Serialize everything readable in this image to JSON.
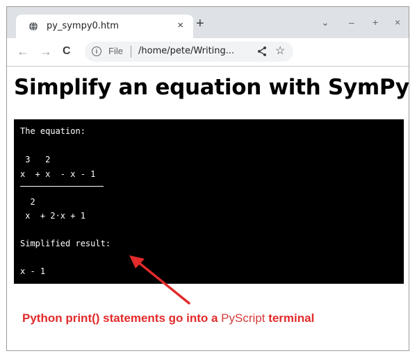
{
  "browser": {
    "tab_title": "py_sympy0.htm",
    "tab_close": "×",
    "new_tab": "+",
    "window_controls": [
      "⌄",
      "–",
      "+",
      "×"
    ],
    "nav": {
      "back": "←",
      "forward": "→",
      "reload": "C"
    },
    "address": {
      "scheme_label": "File",
      "url": "/home/pete/Writing..."
    }
  },
  "page": {
    "heading": "Simplify an equation with SymPy",
    "terminal_lines": [
      "The equation:",
      " 3   2",
      "x  + x  - x - 1",
      "  2",
      " x  + 2·x + 1",
      "Simplified result:",
      "x - 1"
    ]
  },
  "annotation": {
    "text_before": "Python print() statements go into a ",
    "highlight": "PyScript",
    "text_after": " terminal",
    "color": "#e22a2a",
    "highlight_color": "#d63a3a"
  },
  "colors": {
    "tabstrip": "#dee1e6",
    "terminal_bg": "#000000",
    "terminal_fg": "#ffffff"
  }
}
